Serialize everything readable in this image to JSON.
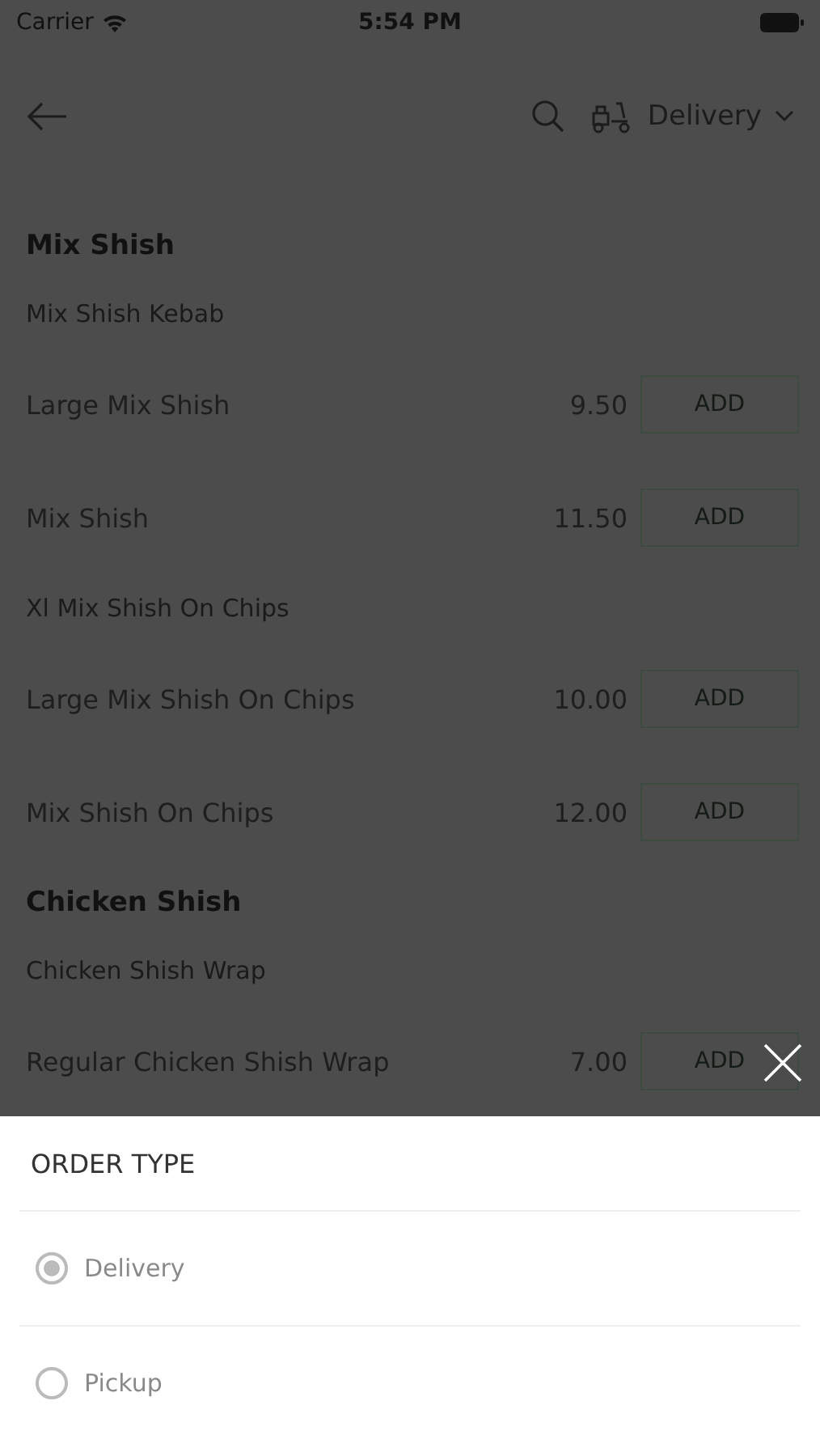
{
  "status_bar": {
    "carrier": "Carrier",
    "time": "5:54 PM"
  },
  "header": {
    "order_type": "Delivery"
  },
  "menu": [
    {
      "kind": "heading",
      "name": "Mix Shish"
    },
    {
      "kind": "subheading",
      "name": "Mix Shish Kebab"
    },
    {
      "kind": "item",
      "name": "Large Mix Shish",
      "price": "9.50",
      "button": "ADD"
    },
    {
      "kind": "item",
      "name": "Mix Shish",
      "price": "11.50",
      "button": "ADD"
    },
    {
      "kind": "subheading",
      "name": "Xl Mix Shish On Chips"
    },
    {
      "kind": "item",
      "name": "Large Mix Shish On Chips",
      "price": "10.00",
      "button": "ADD"
    },
    {
      "kind": "item",
      "name": "Mix Shish On Chips",
      "price": "12.00",
      "button": "ADD"
    },
    {
      "kind": "heading",
      "name": "Chicken Shish"
    },
    {
      "kind": "subheading",
      "name": "Chicken Shish Wrap"
    },
    {
      "kind": "item",
      "name": "Regular Chicken Shish Wrap",
      "price": "7.00",
      "button": "ADD"
    }
  ],
  "sheet": {
    "title": "ORDER TYPE",
    "options": [
      {
        "label": "Delivery",
        "selected": true
      },
      {
        "label": "Pickup",
        "selected": false
      }
    ]
  }
}
